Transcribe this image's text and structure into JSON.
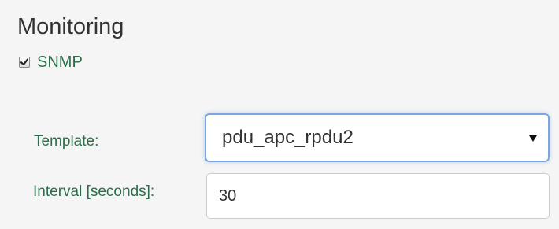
{
  "monitoring": {
    "title": "Monitoring",
    "snmp": {
      "label": "SNMP",
      "checked": true
    }
  },
  "form": {
    "template": {
      "label": "Template:",
      "selected_value": "pdu_apc_rpdu2"
    },
    "interval": {
      "label": "Interval [seconds]:",
      "value": "30"
    }
  },
  "colors": {
    "label_green": "#2a6f4a",
    "focus_border": "#78a7e4",
    "background": "#f5f5f5"
  },
  "icons": {
    "checkbox": "checkmark-icon",
    "dropdown": "caret-down-icon"
  }
}
